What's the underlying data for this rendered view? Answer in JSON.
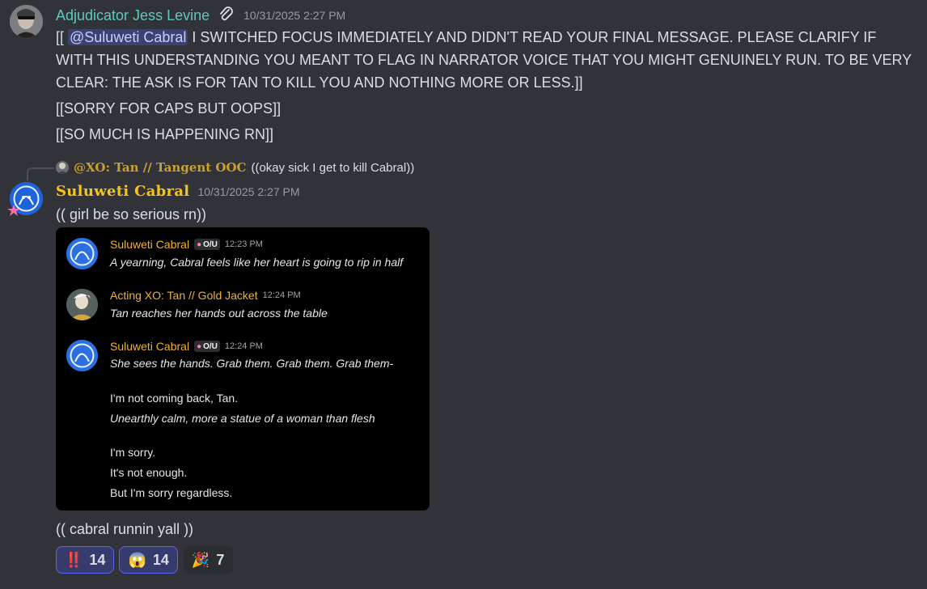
{
  "message1": {
    "author": "Adjudicator Jess Levine",
    "author_color": "#5fc9be",
    "icon": "paperclip-icon",
    "timestamp": "10/31/2025 2:27 PM",
    "line1_prefix": "[[ ",
    "mention": "@Suluweti Cabral",
    "line1_rest": " I SWITCHED FOCUS IMMEDIATELY AND DIDN'T READ YOUR FINAL MESSAGE. PLEASE CLARIFY IF WITH THIS UNDERSTANDING YOU MEANT TO FLAG IN NARRATOR VOICE THAT YOU MIGHT GENUINELY RUN. TO BE VERY CLEAR: THE ASK IS FOR TAN TO KILL YOU AND NOTHING MORE OR LESS.]]",
    "line2": "[[SORRY FOR CAPS BUT OOPS]]",
    "line3": "[[SO MUCH IS HAPPENING RN]]"
  },
  "message2": {
    "reply_author": "@XO: Tan // Tangent OOC",
    "reply_text": "((okay sick I get to kill Cabral))",
    "reply_color": "#c9a227",
    "author": "Suluweti Cabral",
    "author_color": "#f5c518",
    "timestamp": "10/31/2025 2:27 PM",
    "text": "(( girl be so serious rn))",
    "text_after": "(( cabral runnin yall ))"
  },
  "embed": {
    "messages": [
      {
        "name": "Suluweti Cabral",
        "badge": "O/U",
        "time": "12:23 PM",
        "text": "A yearning, Cabral feels like her heart is going to rip in half"
      },
      {
        "name": "Acting XO: Tan // Gold Jacket",
        "badge": "",
        "time": "12:24 PM",
        "text": "Tan reaches her hands out across the table"
      },
      {
        "name": "Suluweti Cabral",
        "badge": "O/U",
        "time": "12:24 PM",
        "text": "She sees the hands. Grab them. Grab them. Grab them-"
      }
    ],
    "extra1": "I'm not coming back, Tan.",
    "extra2": "Unearthly calm, more a statue of a woman than flesh",
    "extra3": "I'm sorry.",
    "extra4": "It's not enough.",
    "extra5": "But I'm sorry regardless."
  },
  "reactions": [
    {
      "emoji": "‼️",
      "count": "14",
      "active": true
    },
    {
      "emoji": "😱",
      "count": "14",
      "active": true
    },
    {
      "emoji": "🎉",
      "count": "7",
      "active": false
    }
  ]
}
